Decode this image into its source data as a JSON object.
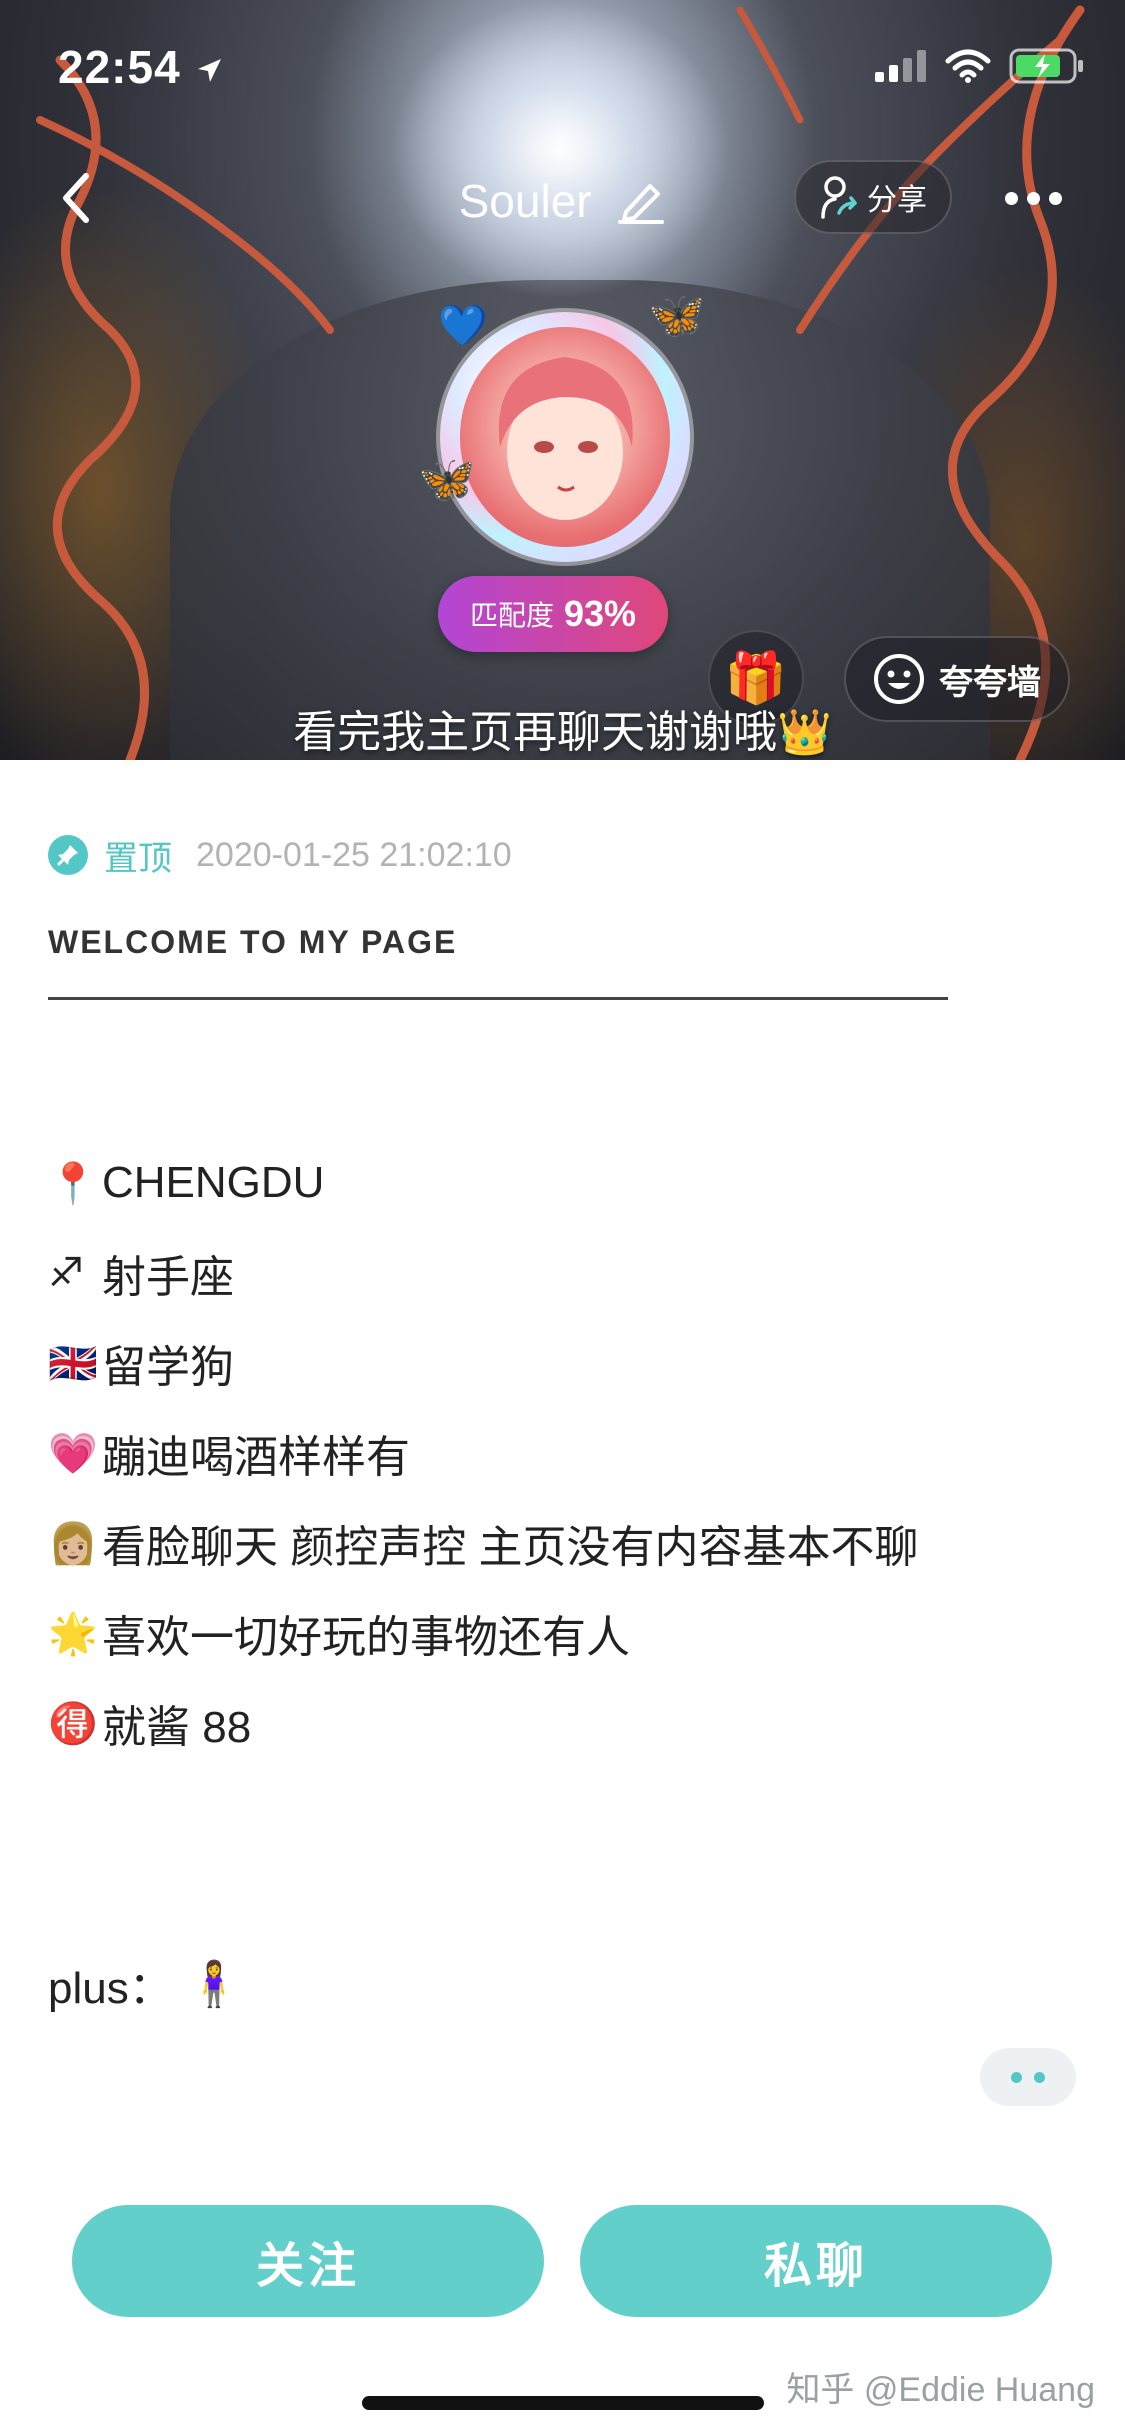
{
  "status_bar": {
    "time": "22:54"
  },
  "navbar": {
    "title": "Souler",
    "share_label": "分享"
  },
  "profile": {
    "match_label": "匹配度",
    "match_value": "93%",
    "praise_label": "夸夸墙",
    "signature": "看完我主页再聊天谢谢哦👑"
  },
  "post": {
    "pin_label": "置顶",
    "date": "2020-01-25 21:02:10",
    "heading": "WELCOME TO MY PAGE",
    "lines": [
      {
        "emoji": "📍",
        "text": "CHENGDU"
      },
      {
        "emoji": "♐",
        "text": "射手座"
      },
      {
        "emoji": "🇬🇧",
        "text": "留学狗"
      },
      {
        "emoji": "💗",
        "text": "蹦迪喝酒样样有"
      },
      {
        "emoji": "👩🏼",
        "text": "看脸聊天 颜控声控 主页没有内容基本不聊"
      },
      {
        "emoji": "🌟",
        "text": "喜欢一切好玩的事物还有人"
      },
      {
        "emoji": "🉐",
        "text": "就酱 88"
      }
    ],
    "plus_label": "plus：",
    "plus_emoji": "🧍‍♀️"
  },
  "actions": {
    "follow_label": "关注",
    "chat_label": "私聊"
  },
  "watermark": "知乎 @Eddie Huang",
  "icons": {
    "status": [
      "location-arrow-icon",
      "cellular-signal-icon",
      "wifi-icon",
      "battery-charging-icon"
    ],
    "navbar": [
      "back-chevron-icon",
      "edit-pencil-icon",
      "share-person-icon",
      "more-dots-icon"
    ],
    "profile": [
      "gift-icon",
      "smiley-icon",
      "pin-icon"
    ]
  },
  "colors": {
    "accent": "#62cfcb",
    "pin": "#52c7c5",
    "match_start": "#b246d6",
    "match_end": "#e0477a"
  }
}
